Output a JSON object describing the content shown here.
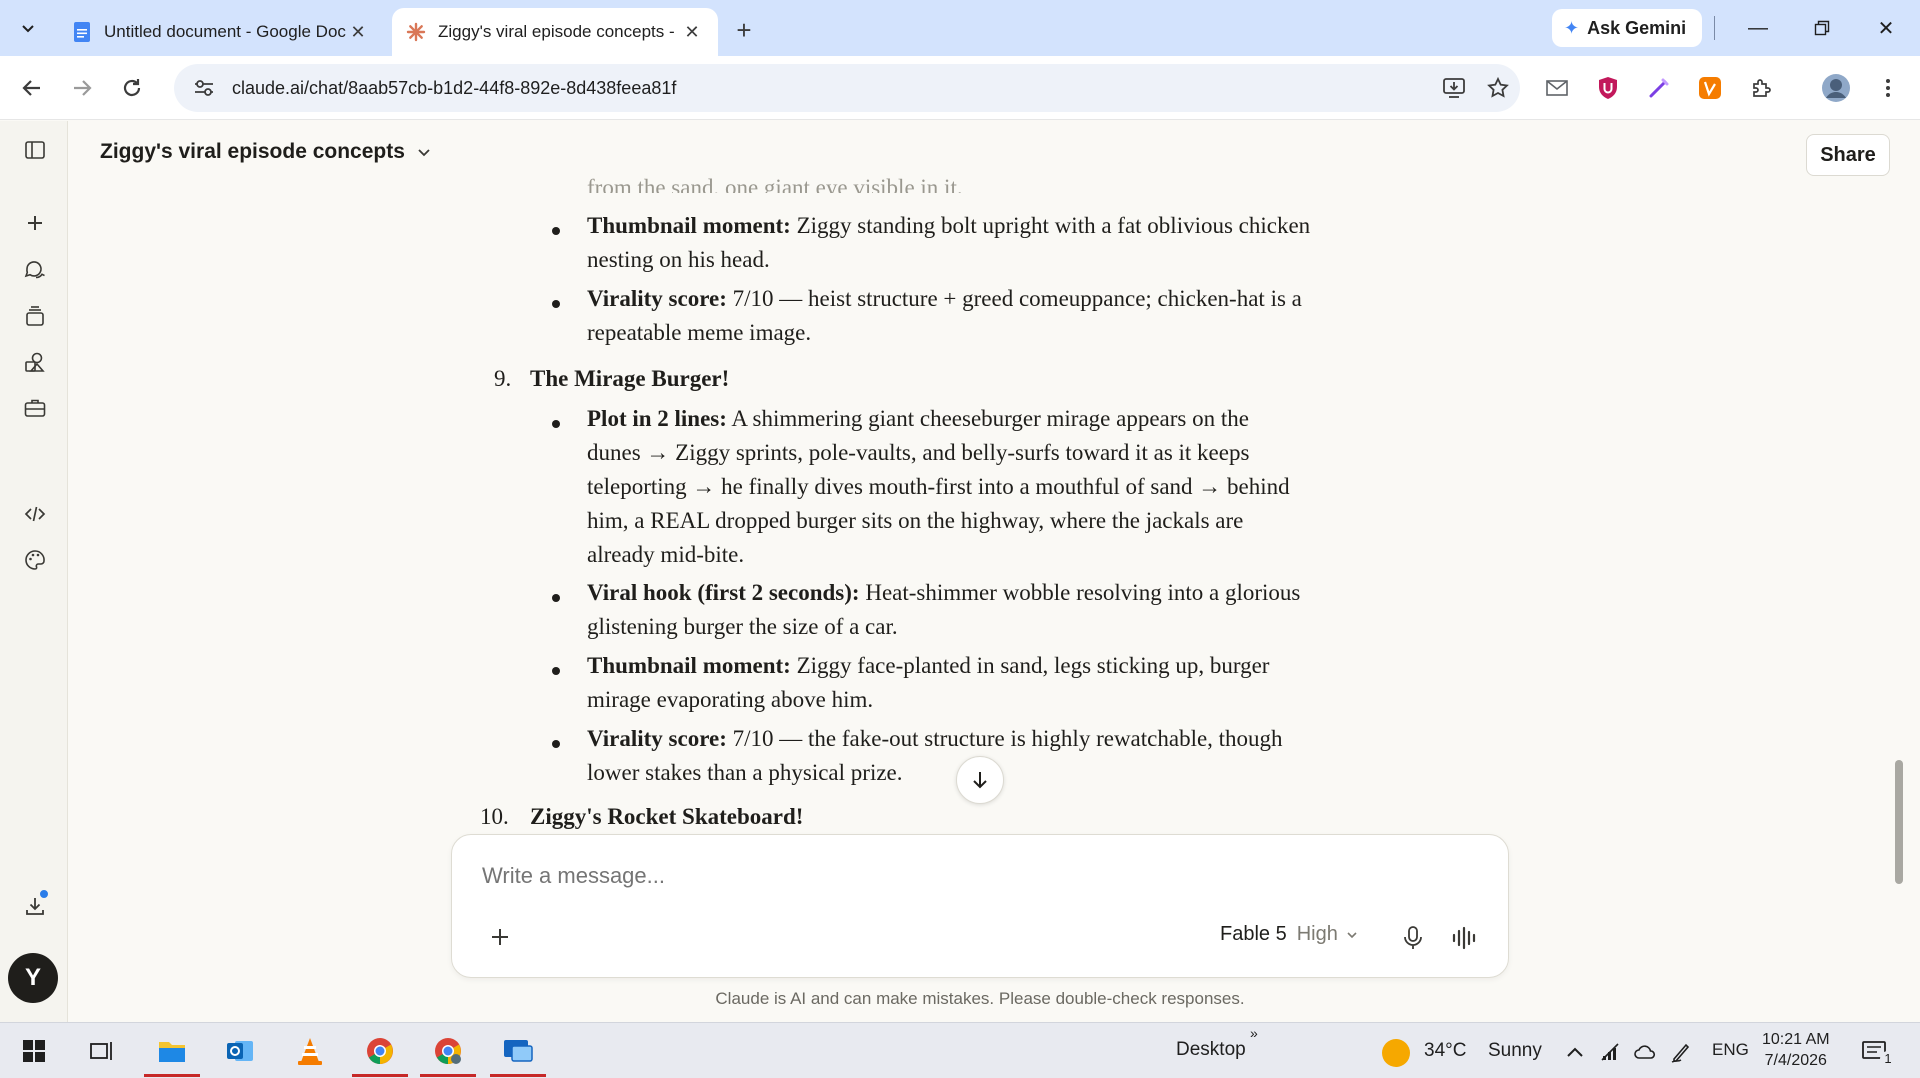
{
  "browser": {
    "tabs": [
      {
        "title": "Untitled document - Google Docs",
        "icon": "google-docs-icon"
      },
      {
        "title": "Ziggy's viral episode concepts - Claude",
        "icon": "claude-icon"
      }
    ],
    "ask_gemini": "Ask Gemini",
    "url": "claude.ai/chat/8aab57cb-b1d2-44f8-892e-8d438feea81f"
  },
  "app": {
    "chat_title": "Ziggy's viral episode concepts",
    "share_label": "Share",
    "avatar_initial": "Y"
  },
  "conversation": {
    "faded_top_line": "from the sand, one giant eye visible in it.",
    "item8_tail": [
      {
        "label": "Thumbnail moment:",
        "lines": [
          "Ziggy standing bolt upright with a fat oblivious chicken",
          "nesting on his head."
        ]
      },
      {
        "label": "Virality score:",
        "lines": [
          "7/10 — heist structure + greed comeuppance; chicken-hat is a",
          "repeatable meme image."
        ]
      }
    ],
    "item9": {
      "number": "9.",
      "title": "The Mirage Burger!",
      "bullets": [
        {
          "label": "Plot in 2 lines:",
          "lines": [
            "A shimmering giant cheeseburger mirage appears on the",
            "dunes → Ziggy sprints, pole-vaults, and belly-surfs toward it as it keeps",
            "teleporting → he finally dives mouth-first into a mouthful of sand → behind",
            "him, a REAL dropped burger sits on the highway, where the jackals are",
            "already mid-bite."
          ]
        },
        {
          "label": "Viral hook (first 2 seconds):",
          "lines": [
            "Heat-shimmer wobble resolving into a glorious",
            "glistening burger the size of a car."
          ]
        },
        {
          "label": "Thumbnail moment:",
          "lines": [
            "Ziggy face-planted in sand, legs sticking up, burger",
            "mirage evaporating above him."
          ]
        },
        {
          "label": "Virality score:",
          "lines": [
            "7/10 — the fake-out structure is highly rewatchable, though",
            "lower stakes than a physical prize."
          ]
        }
      ]
    },
    "item10": {
      "number": "10.",
      "title": "Ziggy's Rocket Skateboard!"
    }
  },
  "composer": {
    "placeholder": "Write a message...",
    "model": "Fable 5",
    "effort": "High",
    "disclaimer": "Claude is AI and can make mistakes. Please double-check responses."
  },
  "taskbar": {
    "desktop_label": "Desktop",
    "weather_temp": "34°C",
    "weather_desc": "Sunny",
    "language": "ENG",
    "time": "10:21 AM",
    "date": "7/4/2026",
    "notification_count": "1"
  },
  "colors": {
    "accent_claude": "#d97757",
    "tabstrip": "#d3e3fd",
    "page_bg": "#faf9f5"
  }
}
